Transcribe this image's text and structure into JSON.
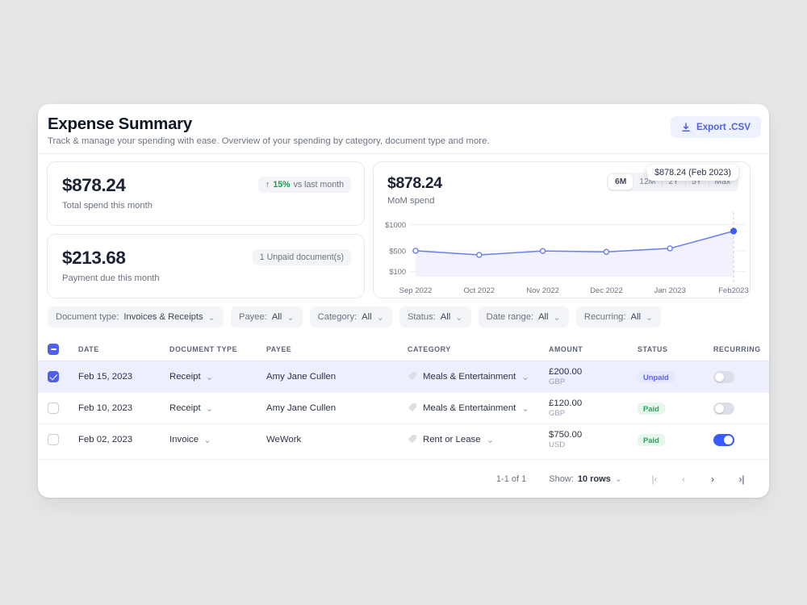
{
  "header": {
    "title": "Expense Summary",
    "subtitle": "Track & manage your spending with ease. Overview of your spending by category, document type and more.",
    "export_label": "Export .CSV"
  },
  "stats": [
    {
      "value": "$878.24",
      "label": "Total spend this month",
      "badge_arrow": "↑",
      "badge_pct": "15%",
      "badge_text": "vs last month"
    },
    {
      "value": "$213.68",
      "label": "Payment due this month",
      "badge_text": "1 Unpaid document(s)"
    }
  ],
  "chart_panel": {
    "value": "$878.24",
    "label": "MoM spend",
    "ranges": [
      "6M",
      "12M",
      "2Y",
      "5Y",
      "Max"
    ],
    "selected_range": "6M",
    "tooltip": "$878.24 (Feb 2023)"
  },
  "chart_data": {
    "type": "line",
    "title": "MoM spend",
    "xlabel": "",
    "ylabel": "",
    "categories": [
      "Sep 2022",
      "Oct 2022",
      "Nov 2022",
      "Dec 2022",
      "Jan 2023",
      "Feb2023"
    ],
    "values": [
      500,
      420,
      495,
      478,
      545,
      878
    ],
    "ytick_labels": [
      "$1000",
      "$500",
      "$100"
    ],
    "yticks": [
      1000,
      500,
      100
    ],
    "ylim": [
      0,
      1150
    ],
    "grid": true,
    "legend": false,
    "line_color": "#6b7ef0",
    "fill_color": "#eef0fd",
    "highlight_point": {
      "category": "Feb2023",
      "value": 878.24,
      "label": "$878.24 (Feb 2023)"
    }
  },
  "filters": [
    {
      "label": "Document type:",
      "value": "Invoices & Receipts"
    },
    {
      "label": "Payee:",
      "value": "All"
    },
    {
      "label": "Category:",
      "value": "All"
    },
    {
      "label": "Status:",
      "value": "All"
    },
    {
      "label": "Date range:",
      "value": "All"
    },
    {
      "label": "Recurring:",
      "value": "All"
    }
  ],
  "table": {
    "columns": [
      "DATE",
      "DOCUMENT TYPE",
      "PAYEE",
      "CATEGORY",
      "AMOUNT",
      "STATUS",
      "RECURRING"
    ],
    "header_checkbox_state": "indeterminate",
    "rows": [
      {
        "selected": true,
        "date": "Feb 15, 2023",
        "doc_type": "Receipt",
        "payee": "Amy Jane Cullen",
        "category": "Meals & Entertainment",
        "amount": "£200.00",
        "currency": "GBP",
        "status": "Unpaid",
        "status_kind": "unpaid",
        "recurring": false
      },
      {
        "selected": false,
        "date": "Feb 10, 2023",
        "doc_type": "Receipt",
        "payee": "Amy Jane Cullen",
        "category": "Meals & Entertainment",
        "amount": "£120.00",
        "currency": "GBP",
        "status": "Paid",
        "status_kind": "paid",
        "recurring": false
      },
      {
        "selected": false,
        "date": "Feb 02, 2023",
        "doc_type": "Invoice",
        "payee": "WeWork",
        "category": "Rent or Lease",
        "amount": "$750.00",
        "currency": "USD",
        "status": "Paid",
        "status_kind": "paid",
        "recurring": true
      }
    ]
  },
  "pagination": {
    "count": "1-1 of 1",
    "show_label": "Show:",
    "rows_value": "10 rows",
    "first": "|‹",
    "prev": "‹",
    "next": "›",
    "last": "›|"
  },
  "colors": {
    "accent": "#4f5fe8",
    "line": "#6b7ef0",
    "paid": "#2f9e5a",
    "unpaid": "#5b63e8",
    "page_bg": "#e7e7e8"
  }
}
